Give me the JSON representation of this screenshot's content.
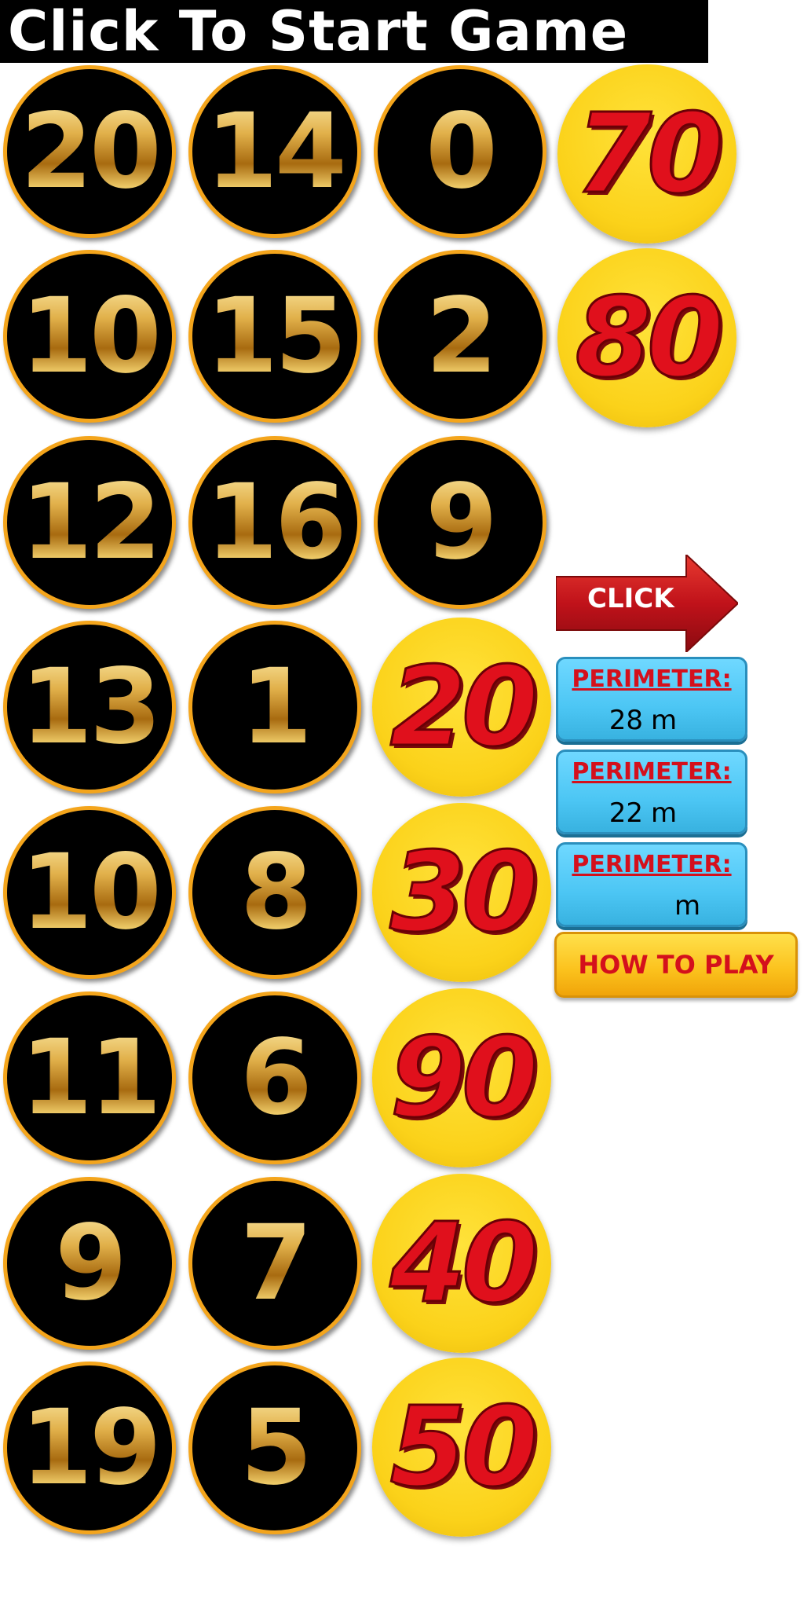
{
  "title": "Click To Start Game",
  "tokens": {
    "col1": [
      "20",
      "10",
      "12",
      "13",
      "10",
      "11",
      "9",
      "19"
    ],
    "col2": [
      "14",
      "15",
      "16",
      "1",
      "8",
      "6",
      "7",
      "5"
    ],
    "col3_black": [
      "0",
      "2",
      "9"
    ],
    "col3_gold": [
      "20",
      "30",
      "90",
      "40",
      "50"
    ],
    "col4_gold": [
      "70",
      "80"
    ]
  },
  "click_label": "CLICK",
  "perimeters": [
    {
      "label": "PERIMETER:",
      "value": "28",
      "unit": "m"
    },
    {
      "label": "PERIMETER:",
      "value": "22",
      "unit": "m"
    },
    {
      "label": "PERIMETER:",
      "value": "",
      "unit": "m"
    }
  ],
  "how_to_play": "HOW TO PLAY",
  "colors": {
    "token_black": "#000000",
    "token_ring": "#f4a51c",
    "token_gold": "#fbd21a",
    "number_red": "#e0101c",
    "perimeter_box": "#4cc6f4",
    "arrow_red": "#c0121a"
  }
}
